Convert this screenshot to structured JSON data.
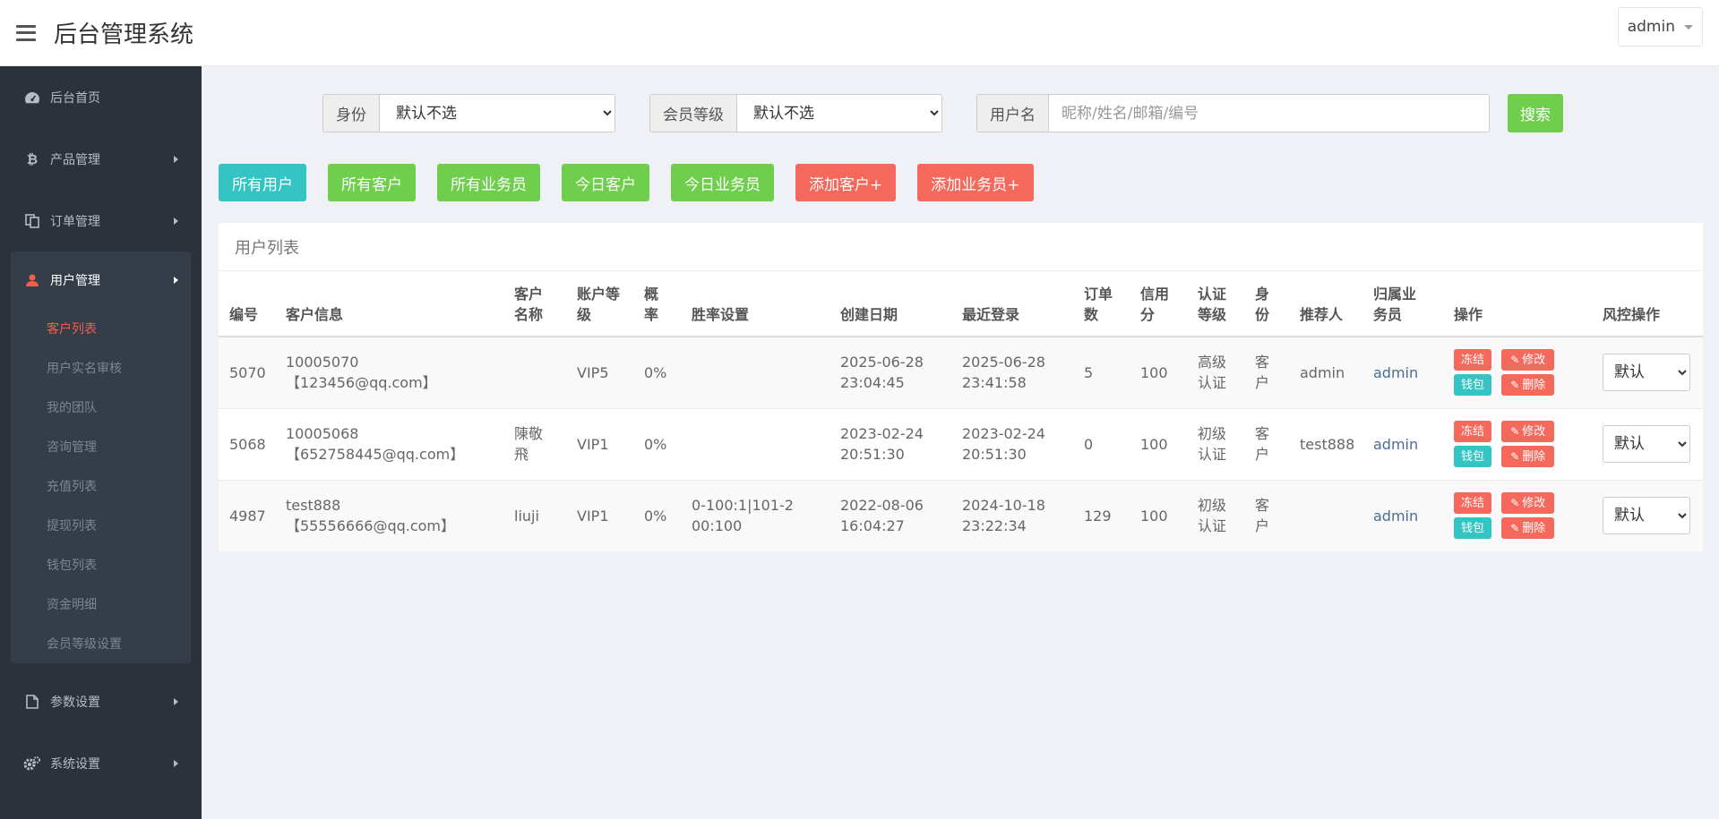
{
  "header": {
    "title": "后台管理系统",
    "user": "admin"
  },
  "sidebar": {
    "items": [
      {
        "label": "后台首页",
        "icon": "dashboard-icon",
        "arrow": false
      },
      {
        "label": "产品管理",
        "icon": "bitcoin-icon",
        "arrow": true
      },
      {
        "label": "订单管理",
        "icon": "copy-icon",
        "arrow": true
      }
    ],
    "group": {
      "label": "用户管理",
      "icon": "user-icon",
      "sub": [
        "客户列表",
        "用户实名审核",
        "我的团队",
        "咨询管理",
        "充值列表",
        "提现列表",
        "钱包列表",
        "资金明细",
        "会员等级设置"
      ]
    },
    "bottom": [
      {
        "label": "参数设置",
        "icon": "file-icon"
      },
      {
        "label": "系统设置",
        "icon": "cogs-icon"
      }
    ]
  },
  "filters": {
    "identity_label": "身份",
    "identity_value": "默认不选",
    "level_label": "会员等级",
    "level_value": "默认不选",
    "username_label": "用户名",
    "username_placeholder": "昵称/姓名/邮箱/编号",
    "search_label": "搜索"
  },
  "actions": {
    "all_users": "所有用户",
    "all_customers": "所有客户",
    "all_salesmen": "所有业务员",
    "today_customers": "今日客户",
    "today_salesmen": "今日业务员",
    "add_customer": "添加客户+",
    "add_salesman": "添加业务员+"
  },
  "table": {
    "title": "用户列表",
    "headers": [
      "编号",
      "客户信息",
      "客户名称",
      "账户等级",
      "概率",
      "胜率设置",
      "创建日期",
      "最近登录",
      "订单数",
      "信用分",
      "认证等级",
      "身份",
      "推荐人",
      "归属业务员",
      "操作",
      "风控操作"
    ],
    "ops": {
      "freeze": "冻结",
      "edit": "修改",
      "wallet": "钱包",
      "delete": "删除"
    },
    "rows": [
      {
        "id": "5070",
        "info1": "10005070",
        "info2": "【123456@qq.com】",
        "name": "",
        "level": "VIP5",
        "prob": "0%",
        "win": "",
        "created1": "2025-06-28",
        "created2": "23:04:45",
        "login1": "2025-06-28",
        "login2": "23:41:58",
        "orders": "5",
        "credit": "100",
        "auth": "高级认证",
        "role": "客户",
        "referrer": "admin",
        "owner": "admin",
        "risk": "默认"
      },
      {
        "id": "5068",
        "info1": "10005068",
        "info2": "【652758445@qq.com】",
        "name": "陳敬飛",
        "level": "VIP1",
        "prob": "0%",
        "win": "",
        "created1": "2023-02-24",
        "created2": "20:51:30",
        "login1": "2023-02-24",
        "login2": "20:51:30",
        "orders": "0",
        "credit": "100",
        "auth": "初级认证",
        "role": "客户",
        "referrer": "test888",
        "owner": "admin",
        "risk": "默认"
      },
      {
        "id": "4987",
        "info1": "test888",
        "info2": "【55556666@qq.com】",
        "name": "liuji",
        "level": "VIP1",
        "prob": "0%",
        "win": "0-100:1|101-200:100",
        "created1": "2022-08-06",
        "created2": "16:04:27",
        "login1": "2024-10-18",
        "login2": "23:22:34",
        "orders": "129",
        "credit": "100",
        "auth": "初级认证",
        "role": "客户",
        "referrer": "",
        "owner": "admin",
        "risk": "默认"
      }
    ]
  }
}
